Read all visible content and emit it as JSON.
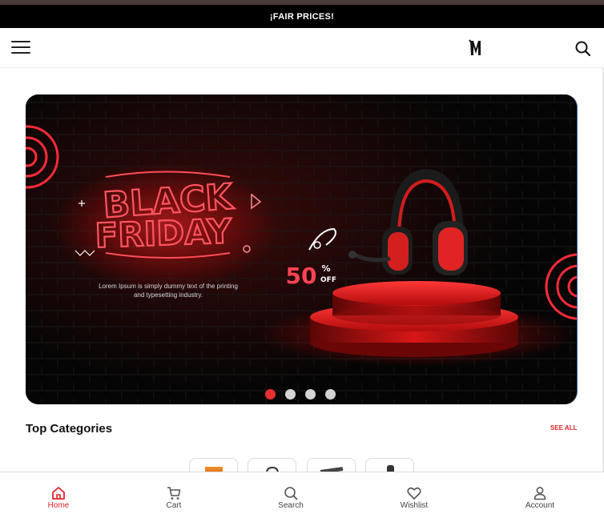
{
  "announcement": "¡FAIR PRICES!",
  "header": {
    "menu_icon": "hamburger-menu-icon",
    "logo_icon": "brand-logo-icon",
    "search_icon": "search-icon"
  },
  "banner": {
    "headline_line1": "BLACK",
    "headline_line2": "FRIDAY",
    "description": "Lorem Ipsum is simply dummy text of the printing and typesetting industry.",
    "discount_number": "50",
    "discount_percent": "%",
    "discount_off": "OFF",
    "slide_count": 4,
    "active_slide": 1
  },
  "categories": {
    "title": "Top Categories",
    "see_all": "SEE ALL"
  },
  "bottom_nav": [
    {
      "label": "Home",
      "icon": "home-icon",
      "active": true
    },
    {
      "label": "Cart",
      "icon": "cart-icon",
      "active": false
    },
    {
      "label": "Search",
      "icon": "search-icon",
      "active": false
    },
    {
      "label": "Wishlist",
      "icon": "heart-icon",
      "active": false
    },
    {
      "label": "Account",
      "icon": "user-icon",
      "active": false
    }
  ],
  "colors": {
    "accent": "#e2232a",
    "announcement_bg": "#000000",
    "dot_active": "#e5312f",
    "dot_inactive": "#d4d4d4"
  }
}
